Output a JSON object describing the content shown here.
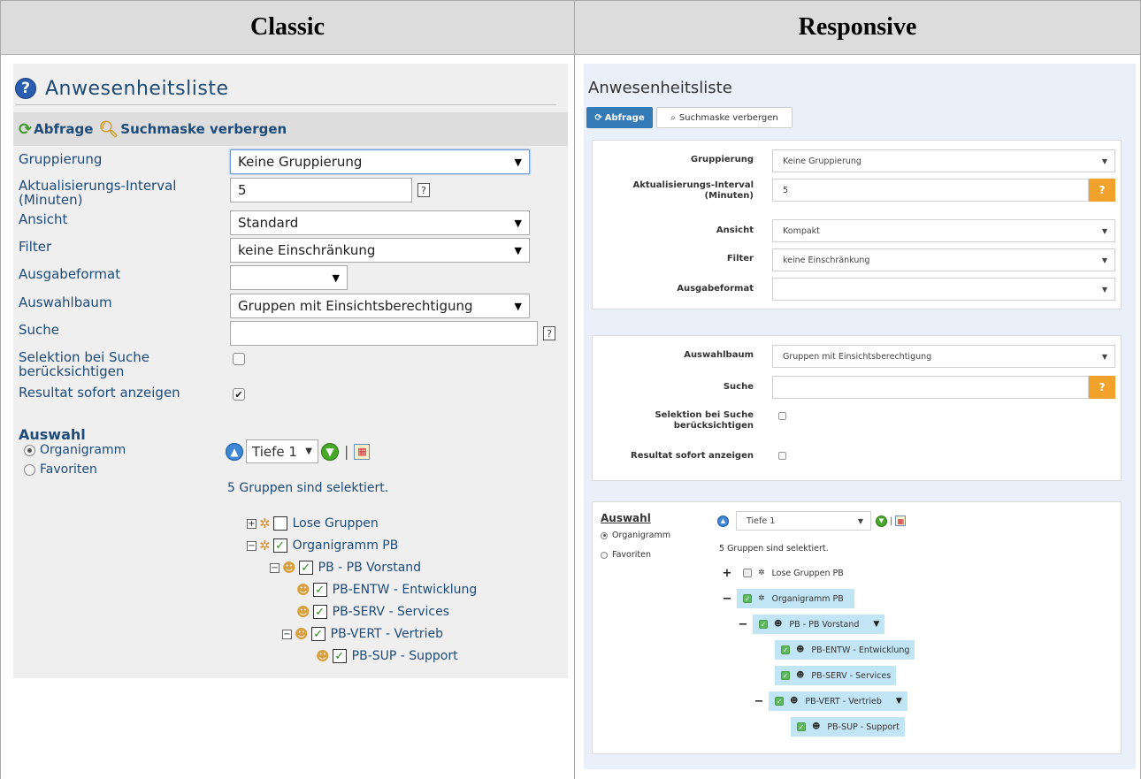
{
  "headers": {
    "classic": "Classic",
    "responsive": "Responsive"
  },
  "classic": {
    "title": "Anwesenheitsliste",
    "toolbar": {
      "query": "Abfrage",
      "hide": "Suchmaske verbergen"
    },
    "fields": {
      "gruppierung": {
        "label": "Gruppierung",
        "value": "Keine Gruppierung"
      },
      "interval": {
        "label": "Aktualisierungs-Interval (Minuten)",
        "value": "5"
      },
      "ansicht": {
        "label": "Ansicht",
        "value": "Standard"
      },
      "filter": {
        "label": "Filter",
        "value": "keine Einschränkung"
      },
      "ausgabeformat": {
        "label": "Ausgabeformat",
        "value": ""
      },
      "auswahlbaum": {
        "label": "Auswahlbaum",
        "value": "Gruppen mit Einsichtsberechtigung"
      },
      "suche": {
        "label": "Suche",
        "value": ""
      },
      "selektion": {
        "label": "Selektion bei Suche berücksichtigen",
        "checked": false
      },
      "resultat": {
        "label": "Resultat sofort anzeigen",
        "checked": true
      }
    },
    "help": "?",
    "auswahl": {
      "heading": "Auswahl",
      "radios": [
        "Organigramm",
        "Favoriten"
      ],
      "tiefe": "Tiefe 1",
      "info": "5 Gruppen sind selektiert.",
      "tree": [
        "Lose Gruppen",
        "Organigramm PB",
        "PB - PB Vorstand",
        "PB-ENTW - Entwicklung",
        "PB-SERV - Services",
        "PB-VERT - Vertrieb",
        "PB-SUP - Support"
      ]
    }
  },
  "responsive": {
    "title": "Anwesenheitsliste",
    "buttons": {
      "query": "Abfrage",
      "hide": "Suchmaske verbergen"
    },
    "fields": {
      "gruppierung": {
        "label": "Gruppierung",
        "value": "Keine Gruppierung"
      },
      "interval": {
        "label": "Aktualisierungs-Interval (Minuten)",
        "value": "5"
      },
      "ansicht": {
        "label": "Ansicht",
        "value": "Kompakt"
      },
      "filter": {
        "label": "Filter",
        "value": "keine Einschränkung"
      },
      "ausgabeformat": {
        "label": "Ausgabeformat",
        "value": ""
      },
      "auswahlbaum": {
        "label": "Auswahlbaum",
        "value": "Gruppen mit Einsichtsberechtigung"
      },
      "suche": {
        "label": "Suche",
        "value": ""
      },
      "selektion": {
        "label": "Selektion bei Suche berücksichtigen",
        "checked": false
      },
      "resultat": {
        "label": "Resultat sofort anzeigen",
        "checked": false
      }
    },
    "help": "?",
    "auswahl": {
      "heading": "Auswahl",
      "radios": [
        "Organigramm",
        "Favoriten"
      ],
      "tiefe": "Tiefe 1",
      "info": "5 Gruppen sind selektiert.",
      "tree": [
        "Lose Gruppen PB",
        "Organigramm PB",
        "PB - PB Vorstand",
        "PB-ENTW - Entwicklung",
        "PB-SERV - Services",
        "PB-VERT - Vertrieb",
        "PB-SUP - Support"
      ]
    }
  },
  "colors": {
    "accent": "#337ab7",
    "warning": "#f0a22a",
    "success": "#5cb85c",
    "label_blue": "#1d4b7a",
    "tree_highlight": "#c2e5f6"
  }
}
